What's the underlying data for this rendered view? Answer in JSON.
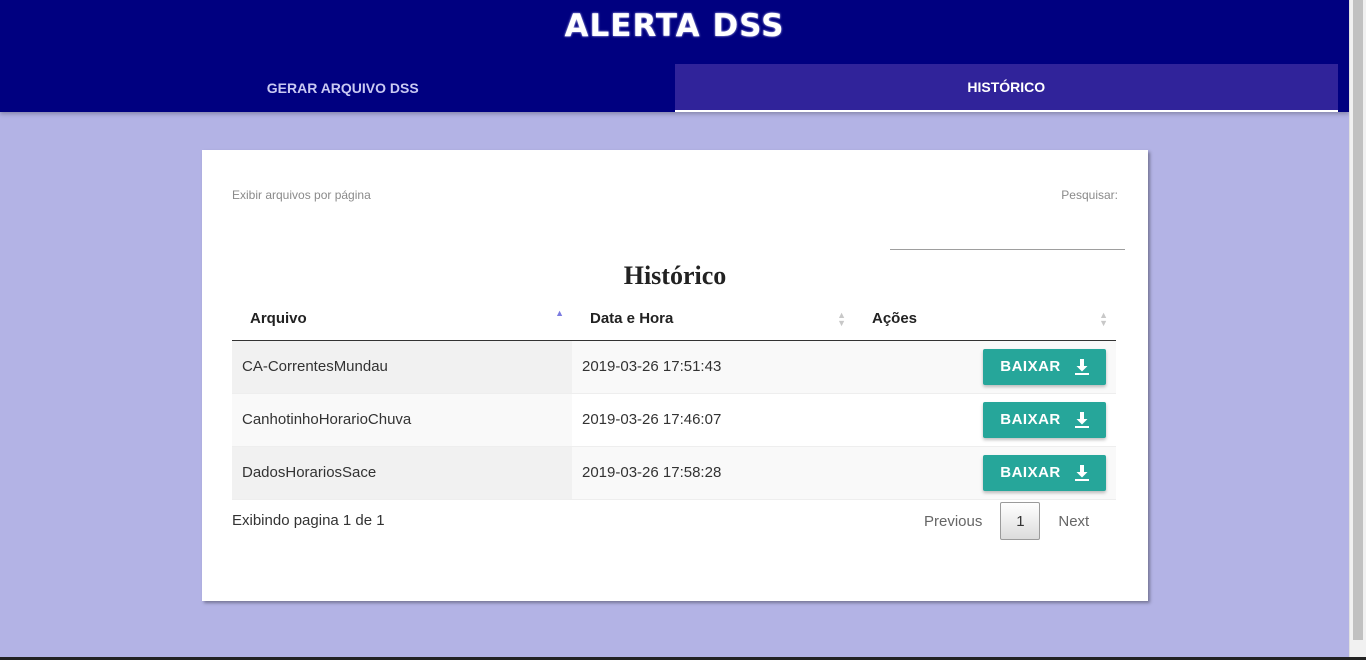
{
  "header": {
    "title": "ALERTA DSS",
    "tabs": [
      {
        "label": "GERAR ARQUIVO DSS",
        "active": false
      },
      {
        "label": "HISTÓRICO",
        "active": true
      }
    ]
  },
  "table_controls": {
    "length_label": "Exibir arquivos por página",
    "search_label": "Pesquisar:",
    "search_value": ""
  },
  "table": {
    "caption": "Histórico",
    "columns": [
      "Arquivo",
      "Data e Hora",
      "Ações"
    ],
    "sorted_column": "Arquivo",
    "rows": [
      {
        "arquivo": "CA-CorrentesMundau",
        "data_hora": "2019-03-26 17:51:43",
        "action_label": "BAIXAR"
      },
      {
        "arquivo": "CanhotinhoHorarioChuva",
        "data_hora": "2019-03-26 17:46:07",
        "action_label": "BAIXAR"
      },
      {
        "arquivo": "DadosHorariosSace",
        "data_hora": "2019-03-26 17:58:28",
        "action_label": "BAIXAR"
      }
    ]
  },
  "pagination": {
    "info": "Exibindo pagina 1 de 1",
    "previous_label": "Previous",
    "next_label": "Next",
    "current_page": "1"
  },
  "colors": {
    "header_bg": "#000080",
    "active_tab_bg": "#30239a",
    "page_bg": "#b3b3e5",
    "button_bg": "#26a69a"
  },
  "icons": {
    "download": "download-icon",
    "sort": "sort-icon"
  }
}
